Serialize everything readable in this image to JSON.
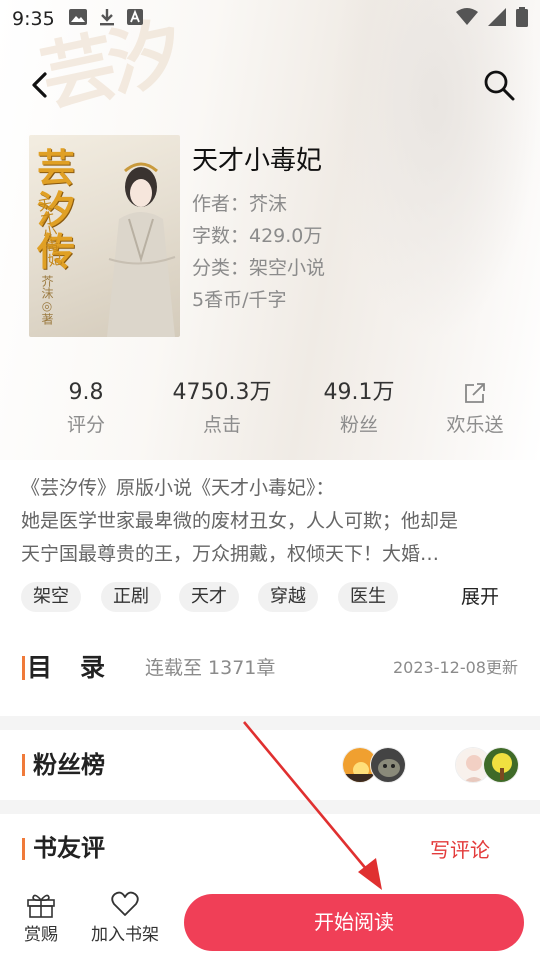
{
  "status_bar": {
    "time": "9:35",
    "icons_left": [
      "image-icon",
      "download-icon",
      "text-a-icon"
    ],
    "icons_right": [
      "wifi-icon",
      "signal-icon",
      "battery-icon"
    ]
  },
  "book": {
    "cover_title": "芸汐传",
    "cover_subtitle": "天才小毒妃",
    "cover_author": "芥沫◎著",
    "title": "天才小毒妃",
    "author": "作者：芥沫",
    "word_count": "字数：429.0万",
    "category": "分类：架空小说",
    "price": "5香币/千字"
  },
  "stats": [
    {
      "value": "9.8",
      "label": "评分"
    },
    {
      "value": "4750.3万",
      "label": "点击"
    },
    {
      "value": "49.1万",
      "label": "粉丝"
    },
    {
      "value": "",
      "label": "欢乐送"
    }
  ],
  "description": {
    "line1": "《芸汐传》原版小说《天才小毒妃》：",
    "line2": "她是医学世家最卑微的废材丑女，人人可欺；他却是",
    "line3": "天宁国最尊贵的王，万众拥戴，权倾天下！大婚…"
  },
  "tags": [
    "架空",
    "正剧",
    "天才",
    "穿越",
    "医生"
  ],
  "expand_label": "展开",
  "toc": {
    "title": "目录",
    "status": "连载至 1371章",
    "date": "2023-12-08更新"
  },
  "fans": {
    "title": "粉丝榜"
  },
  "reviews": {
    "title": "书友评",
    "write_label": "写评论"
  },
  "bottom": {
    "reward_label": "赏赐",
    "shelf_label": "加入书架",
    "read_label": "开始阅读"
  },
  "colors": {
    "accent": "#f03f57",
    "section_marker": "#f07a3a",
    "annotation_arrow": "#e03030"
  }
}
